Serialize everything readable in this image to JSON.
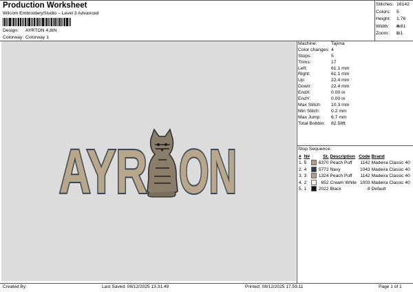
{
  "header": {
    "title": "Production Worksheet",
    "subtitle": "Wilcom EmbroideryStudio – Level 3 Advanced",
    "design_label": "Design:",
    "design_value": "AYRTON 4,8IN",
    "colorway_label": "Colorway:",
    "colorway_value": "Colorway 1"
  },
  "stats": [
    {
      "label": "Stitches:",
      "value": "16142"
    },
    {
      "label": "Colors:",
      "value": "5"
    },
    {
      "label": "Height:",
      "value": "1.76 in"
    },
    {
      "label": "Width:",
      "value": "4.81 in"
    },
    {
      "label": "Zoom:",
      "value": "1:1"
    }
  ],
  "machine": [
    {
      "label": "Machine:",
      "value": "Tajima"
    },
    {
      "label": "Color changes:",
      "value": "4"
    },
    {
      "label": "Stops:",
      "value": "5"
    },
    {
      "label": "Trims:",
      "value": "17"
    },
    {
      "label": "Left:",
      "value": "61.1 mm"
    },
    {
      "label": "Right:",
      "value": "61.1 mm"
    },
    {
      "label": "Up:",
      "value": "22.4 mm"
    },
    {
      "label": "Down:",
      "value": "22.4 mm"
    },
    {
      "label": "EndX:",
      "value": "0.00 in"
    },
    {
      "label": "EndY:",
      "value": "0.00 in"
    },
    {
      "label": "Max Stitch:",
      "value": "10.3 mm"
    },
    {
      "label": "Min Stitch:",
      "value": "0.2 mm"
    },
    {
      "label": "Max Jump:",
      "value": "6.7 mm"
    },
    {
      "label": "Total Bobbin:",
      "value": "82.58ft"
    }
  ],
  "stop_sequence": {
    "title": "Stop Sequence:",
    "headers": [
      "#",
      "N#",
      "St.",
      "Description",
      "Code",
      "Brand"
    ],
    "rows": [
      {
        "num": "1.",
        "n": "5",
        "color": "#b49f86",
        "st": "6370",
        "desc": "Peach Puff",
        "code": "1142",
        "brand": "Madeira Classic 40"
      },
      {
        "num": "2.",
        "n": "4",
        "color": "#2e3a44",
        "st": "5772",
        "desc": "Navy",
        "code": "1043",
        "brand": "Madeira Classic 40"
      },
      {
        "num": "3.",
        "n": "3",
        "color": "#b49f86",
        "st": "1324",
        "desc": "Peach Puff",
        "code": "1142",
        "brand": "Madeira Classic 40"
      },
      {
        "num": "4.",
        "n": "2",
        "color": "#f4efe6",
        "st": "652",
        "desc": "Cream White",
        "code": "1003",
        "brand": "Madeira Classic 40"
      },
      {
        "num": "5.",
        "n": "1",
        "color": "#111111",
        "st": "2022",
        "desc": "Black",
        "code": "8",
        "brand": "Default"
      }
    ]
  },
  "design": {
    "text_left": "AYR",
    "text_right": "ON",
    "fill_color": "#b9a78c",
    "outline_color": "#3a4650",
    "background": "#dcdcdc"
  },
  "footer": {
    "created_by": "Created By:",
    "last_saved": "Last Saved: 08/12/2025 13.31.49",
    "printed": "Printed: 08/12/2025 17.59.11",
    "page": "Page 1 of 1"
  }
}
